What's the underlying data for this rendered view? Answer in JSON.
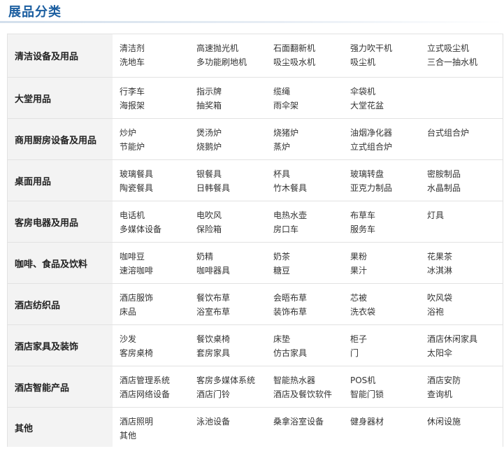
{
  "header": {
    "title": "展品分类"
  },
  "categories": [
    {
      "name": "清洁设备及用品",
      "items": [
        "清洁剂",
        "高速抛光机",
        "石面翻新机",
        "强力吹干机",
        "立式吸尘机",
        "洗地车",
        "多功能刷地机",
        "吸尘吸水机",
        "吸尘机",
        "三合一抽水机"
      ]
    },
    {
      "name": "大堂用品",
      "items": [
        "行李车",
        "指示牌",
        "缆绳",
        "伞袋机",
        "",
        "海报架",
        "抽奖箱",
        "雨伞架",
        "大堂花盆",
        ""
      ]
    },
    {
      "name": "商用厨房设备及用品",
      "items": [
        "炒炉",
        "煲汤炉",
        "烧猪炉",
        "油烟净化器",
        "台式组合炉",
        "节能炉",
        "烧鹅炉",
        "蒸炉",
        "立式组合炉",
        ""
      ]
    },
    {
      "name": "桌面用品",
      "items": [
        "玻璃餐具",
        "银餐具",
        "杯具",
        "玻璃转盘",
        "密胺制品",
        "陶瓷餐具",
        "日韩餐具",
        "竹木餐具",
        "亚克力制品",
        "水晶制品"
      ]
    },
    {
      "name": "客房电器及用品",
      "items": [
        "电话机",
        "电吹风",
        "电热水壶",
        "布草车",
        "灯具",
        "多媒体设备",
        "保险箱",
        "房口车",
        "服务车",
        ""
      ]
    },
    {
      "name": "咖啡、食品及饮料",
      "items": [
        "咖啡豆",
        "奶精",
        "奶茶",
        "果粉",
        "花果茶",
        "速溶咖啡",
        "咖啡器具",
        "糖豆",
        "果汁",
        "冰淇淋"
      ]
    },
    {
      "name": "酒店纺织品",
      "items": [
        "酒店服饰",
        "餐饮布草",
        "会晤布草",
        "芯被",
        "吹风袋",
        "床品",
        "浴室布草",
        "装饰布草",
        "洗衣袋",
        "浴袍"
      ]
    },
    {
      "name": "酒店家具及装饰",
      "items": [
        "沙发",
        "餐饮桌椅",
        "床垫",
        "柜子",
        "酒店休闲家具",
        "客房桌椅",
        "套房家具",
        "仿古家具",
        "门",
        "太阳伞"
      ]
    },
    {
      "name": "酒店智能产品",
      "items": [
        "酒店管理系统",
        "客房多媒体系统",
        "智能热水器",
        "POS机",
        "酒店安防",
        "酒店网络设备",
        "酒店门铃",
        "酒店及餐饮软件",
        "智能门锁",
        "查询机"
      ]
    },
    {
      "name": "其他",
      "items": [
        "酒店照明",
        "泳池设备",
        "桑拿浴室设备",
        "健身器材",
        "休闲设施",
        "其他",
        "",
        "",
        "",
        ""
      ]
    }
  ]
}
